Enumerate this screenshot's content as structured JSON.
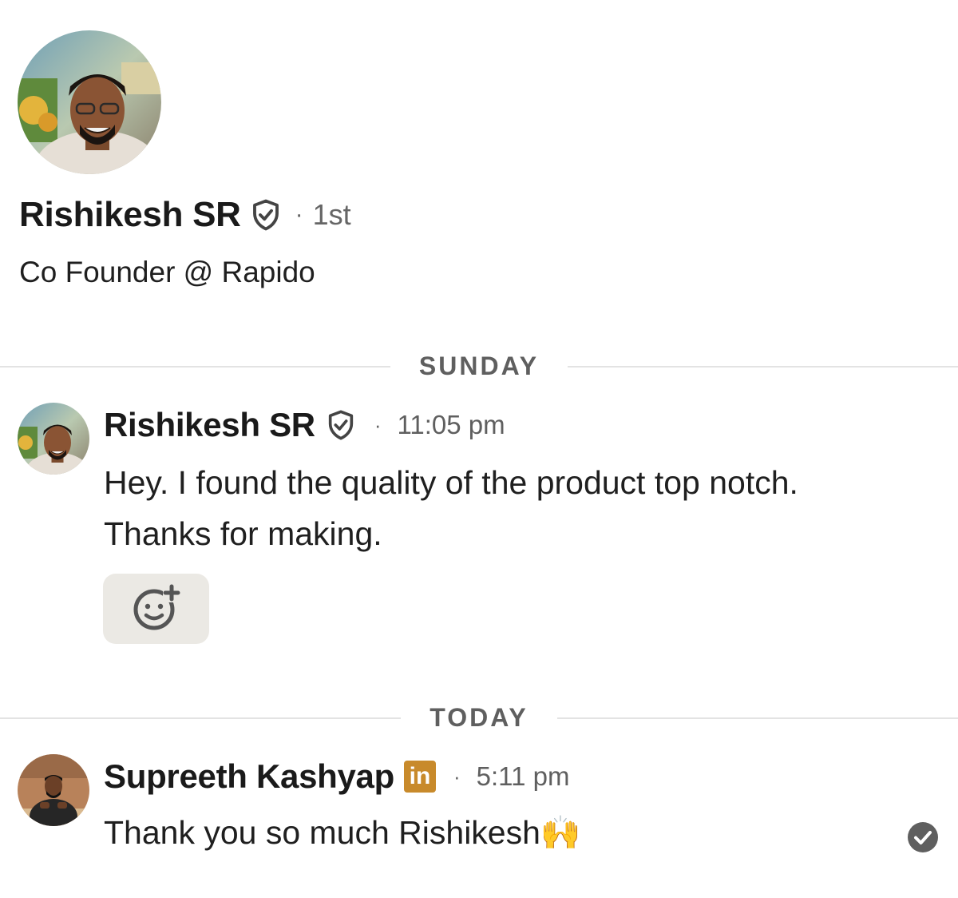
{
  "profile": {
    "name": "Rishikesh SR",
    "degree": "1st",
    "separator": "·",
    "headline": "Co Founder @ Rapido",
    "avatar_icon": "profile-photo",
    "verified_icon": "shield-check-icon"
  },
  "dividers": {
    "first": "SUNDAY",
    "second": "TODAY"
  },
  "messages": [
    {
      "sender": "Rishikesh SR",
      "separator": "·",
      "time": "11:05 pm",
      "lines": [
        "Hey. I found the quality of the product top notch.",
        "Thanks for making."
      ],
      "badge": "shield-check-icon"
    },
    {
      "sender": "Supreeth Kashyap",
      "separator": "·",
      "time": "5:11 pm",
      "lines": [
        "Thank you so much Rishikesh🙌"
      ],
      "badge": "linkedin-icon",
      "badge_text": "in"
    }
  ],
  "reaction": {
    "icon": "add-reaction-icon"
  },
  "status": {
    "icon": "read-check-icon"
  },
  "colors": {
    "badge_gold": "#c88a2b",
    "reaction_bg": "#ebe9e4",
    "divider_line": "#e3e3e3",
    "muted_text": "#5f5f5f"
  }
}
